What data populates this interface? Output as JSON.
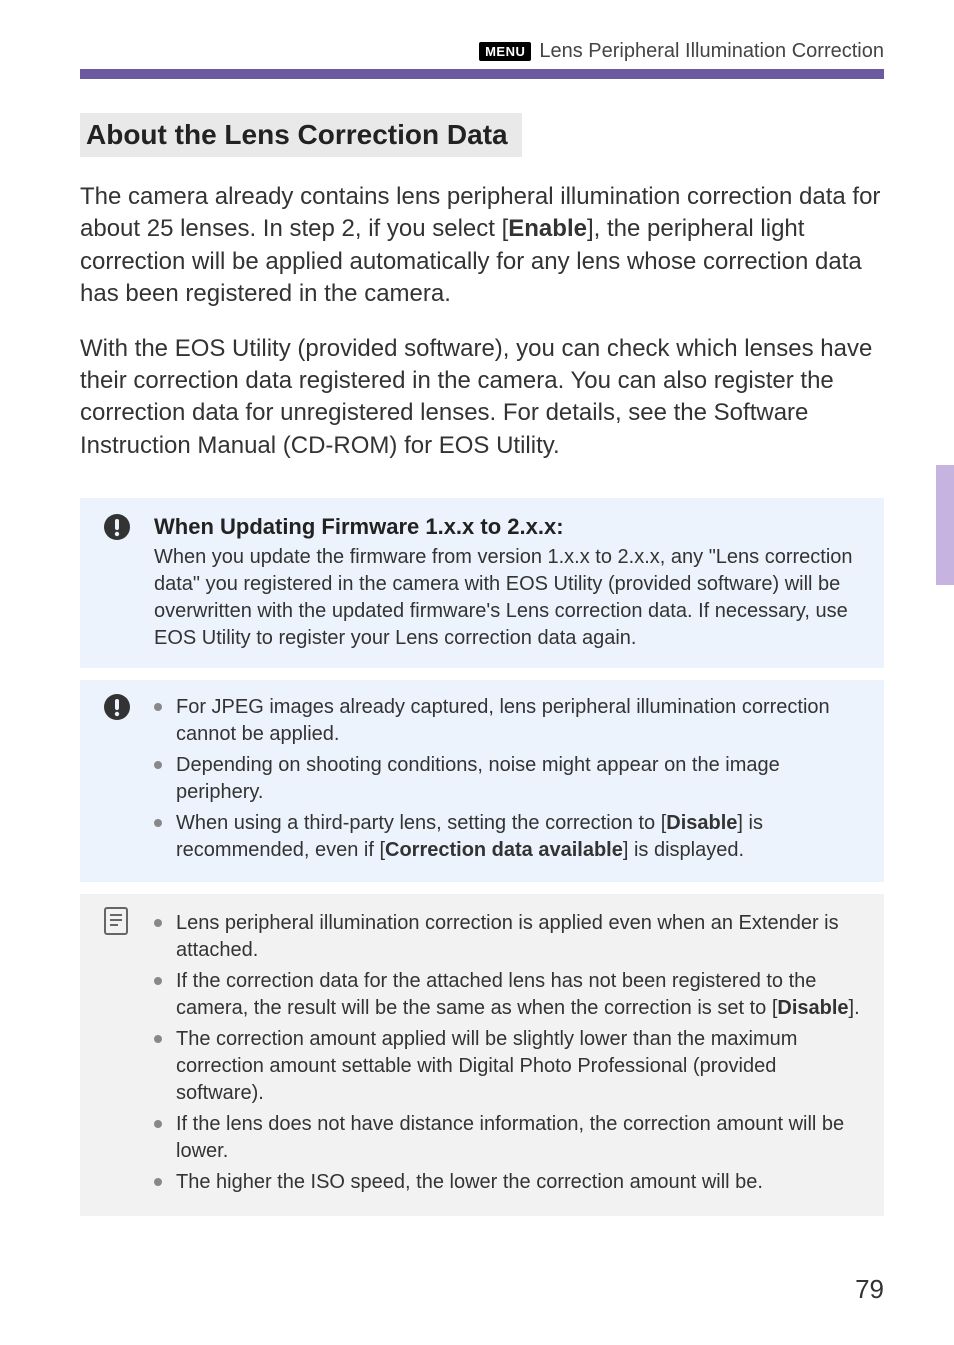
{
  "header": {
    "badge": "MENU",
    "title": "Lens Peripheral Illumination Correction"
  },
  "section_title": "About the Lens Correction Data",
  "para1_a": "The camera already contains lens peripheral illumination correction data for about 25 lenses. In step 2, if you select [",
  "para1_bold": "Enable",
  "para1_b": "], the peripheral light correction will be applied automatically for any lens whose correction data has been registered in the camera.",
  "para2": "With the EOS Utility (provided software), you can check which lenses have their correction data registered in the camera. You can also register the correction data for unregistered lenses. For details, see the Software Instruction Manual (CD-ROM) for EOS Utility.",
  "caution1": {
    "heading": "When Updating Firmware 1.x.x to 2.x.x:",
    "body": "When you update the firmware from version 1.x.x to 2.x.x, any \"Lens correction data\" you registered in the camera with EOS Utility (provided software) will be overwritten with the updated firmware's Lens correction data. If necessary, use EOS Utility to register your Lens correction data again."
  },
  "caution2": {
    "items": [
      {
        "a": "For JPEG images already captured, lens peripheral illumination correction cannot be applied."
      },
      {
        "a": "Depending on shooting conditions, noise might appear on the image periphery."
      },
      {
        "a": "When using a third-party lens, setting the correction to [",
        "b1": "Disable",
        "c": "] is recommended, even if [",
        "b2": "Correction data available",
        "d": "] is displayed."
      }
    ]
  },
  "notes": {
    "items": [
      {
        "a": "Lens peripheral illumination correction is applied even when an Extender is attached."
      },
      {
        "a": "If the correction data for the attached lens has not been registered to the camera, the result will be the same as when the correction is set to [",
        "b1": "Disable",
        "c": "]."
      },
      {
        "a": "The correction amount applied will be slightly lower than the maximum correction amount settable with Digital Photo Professional (provided software)."
      },
      {
        "a": "If the lens does not have distance information, the correction amount will be lower."
      },
      {
        "a": "The higher the ISO speed, the lower the correction amount will be."
      }
    ]
  },
  "page_number": "79"
}
